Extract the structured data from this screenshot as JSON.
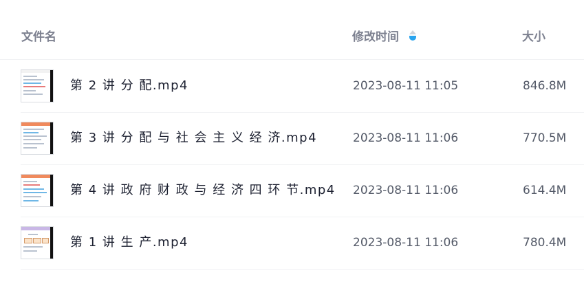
{
  "header": {
    "name_label": "文件名",
    "time_label": "修改时间",
    "size_label": "大小"
  },
  "sort_icon": "sort-descending-icon",
  "files": [
    {
      "name": "第 2 讲 分 配.mp4",
      "modified": "2023-08-11 11:05",
      "size": "846.8M",
      "thumb_accent": "#f2f2f2"
    },
    {
      "name": "第 3 讲 分 配 与 社 会 主 义 经 济.mp4",
      "modified": "2023-08-11 11:06",
      "size": "770.5M",
      "thumb_accent": "#f08a5d"
    },
    {
      "name": "第 4 讲 政 府 财 政 与 经 济 四 环 节.mp4",
      "modified": "2023-08-11 11:06",
      "size": "614.4M",
      "thumb_accent": "#f08a5d"
    },
    {
      "name": "第 1 讲 生 产.mp4",
      "modified": "2023-08-11 11:06",
      "size": "780.4M",
      "thumb_accent": "#c9b7e6"
    }
  ]
}
